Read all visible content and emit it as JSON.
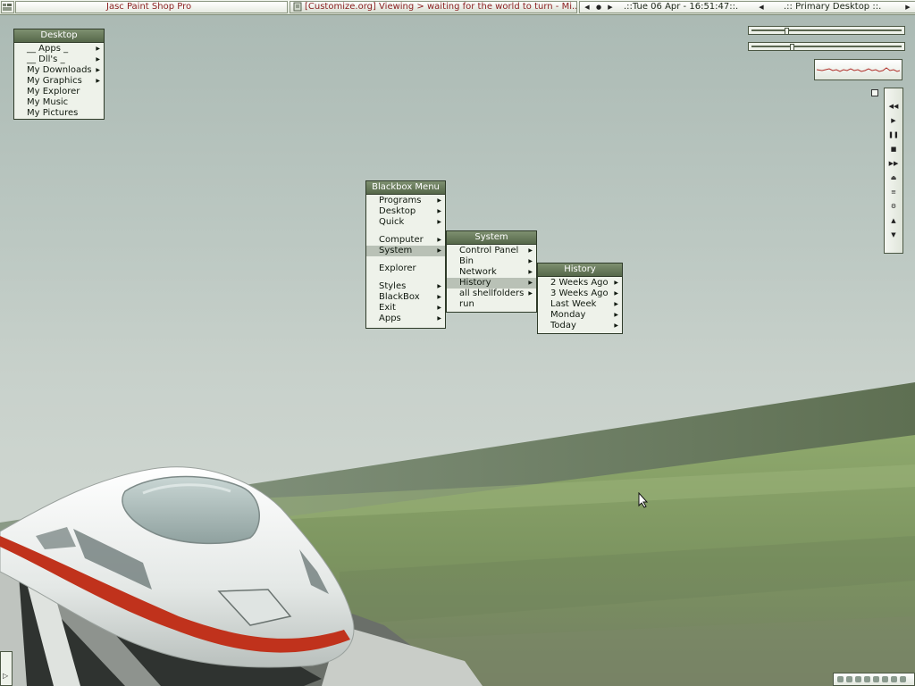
{
  "taskbar": {
    "window1_title": "Jasc Paint Shop Pro",
    "window2_title": "[Customize.org] Viewing > waiting for the world to turn - Mi...",
    "clock": ".::Tue 06 Apr - 16:51:47::.",
    "workspace": ".:: Primary Desktop ::."
  },
  "desktop_menu": {
    "title": "Desktop",
    "items": [
      {
        "label": "__ Apps _",
        "submenu": true
      },
      {
        "label": "__ Dll's _",
        "submenu": true
      },
      {
        "label": "My Downloads",
        "submenu": true
      },
      {
        "label": "My Graphics",
        "submenu": true
      },
      {
        "label": "My Explorer",
        "submenu": false
      },
      {
        "label": "My Music",
        "submenu": false
      },
      {
        "label": "My Pictures",
        "submenu": false
      }
    ]
  },
  "blackbox_menu": {
    "title": "Blackbox Menu",
    "items": [
      {
        "label": "Programs",
        "submenu": true
      },
      {
        "label": "Desktop",
        "submenu": true
      },
      {
        "label": "Quick",
        "submenu": true
      },
      {
        "label": "Computer",
        "submenu": true
      },
      {
        "label": "System",
        "submenu": true,
        "active": true
      },
      {
        "label": "Explorer",
        "submenu": false
      },
      {
        "label": "Styles",
        "submenu": true
      },
      {
        "label": "BlackBox",
        "submenu": true
      },
      {
        "label": "Exit",
        "submenu": true
      },
      {
        "label": "Apps",
        "submenu": true
      }
    ]
  },
  "system_menu": {
    "title": "System",
    "items": [
      {
        "label": "Control Panel",
        "submenu": true
      },
      {
        "label": "Bin",
        "submenu": true
      },
      {
        "label": "Network",
        "submenu": true
      },
      {
        "label": "History",
        "submenu": true,
        "active": true
      },
      {
        "label": "all shellfolders",
        "submenu": true
      },
      {
        "label": "run",
        "submenu": false
      }
    ]
  },
  "history_menu": {
    "title": "History",
    "items": [
      {
        "label": "2 Weeks Ago",
        "submenu": true
      },
      {
        "label": "3 Weeks Ago",
        "submenu": true
      },
      {
        "label": "Last Week",
        "submenu": true
      },
      {
        "label": "Monday",
        "submenu": true
      },
      {
        "label": "Today",
        "submenu": true
      }
    ]
  },
  "sliders": {
    "slider1_level": 0.22,
    "slider2_level": 0.26
  },
  "media_controls": [
    "rewind-icon",
    "play-icon",
    "pause-icon",
    "stop-icon",
    "fast-forward-icon",
    "eject-icon",
    "playlist-icon",
    "settings-icon",
    "volume-up-icon",
    "volume-down-icon"
  ],
  "colors": {
    "menu_title_bg": "#56684a",
    "menu_bg": "#eef2ea",
    "menu_active": "#b9c1b6",
    "taskbar_text_red": "#8a1e1e",
    "grass": "#7c9560",
    "train_stripe": "#c0321c"
  }
}
